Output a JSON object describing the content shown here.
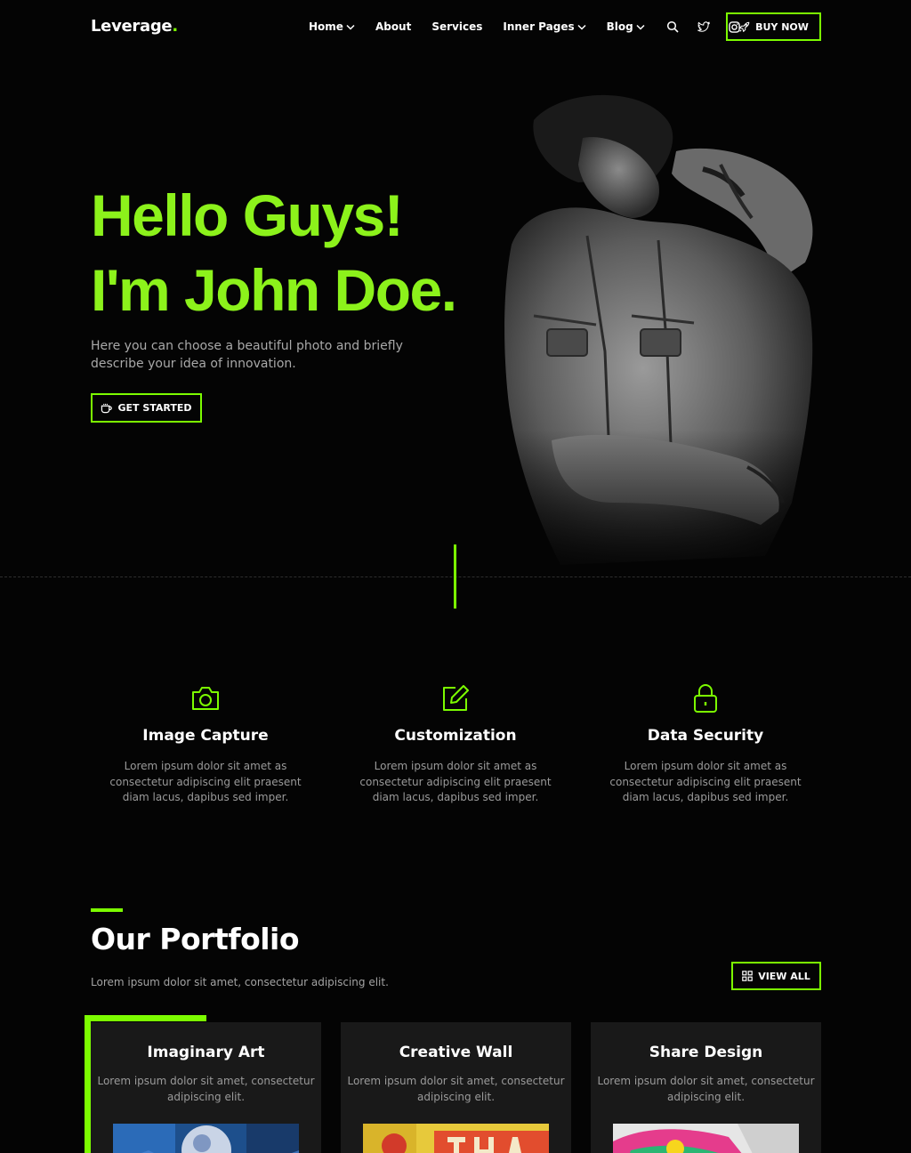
{
  "brand": {
    "name": "Leverage",
    "dot": ".",
    "accent": "#7cfc00"
  },
  "nav": {
    "items": [
      {
        "label": "Home",
        "dropdown": true
      },
      {
        "label": "About",
        "dropdown": false
      },
      {
        "label": "Services",
        "dropdown": false
      },
      {
        "label": "Inner Pages",
        "dropdown": true
      },
      {
        "label": "Blog",
        "dropdown": true
      }
    ],
    "icons": [
      "search-icon",
      "twitter-icon",
      "instagram-icon"
    ],
    "buy_label": "BUY NOW"
  },
  "hero": {
    "line1": "Hello Guys!",
    "line2": "I'm John Doe.",
    "description": "Here you can choose a beautiful photo and briefly describe your idea of innovation.",
    "cta_label": "GET STARTED"
  },
  "features": [
    {
      "icon": "camera-icon",
      "title": "Image Capture",
      "text": "Lorem ipsum dolor sit amet as consectetur adipiscing elit praesent diam lacus, dapibus sed imper."
    },
    {
      "icon": "edit-icon",
      "title": "Customization",
      "text": "Lorem ipsum dolor sit amet as consectetur adipiscing elit praesent diam lacus, dapibus sed imper."
    },
    {
      "icon": "lock-icon",
      "title": "Data Security",
      "text": "Lorem ipsum dolor sit amet as consectetur adipiscing elit praesent diam lacus, dapibus sed imper."
    }
  ],
  "portfolio": {
    "title": "Our Portfolio",
    "description": "Lorem ipsum dolor sit amet, consectetur adipiscing elit.",
    "view_all_label": "VIEW ALL",
    "cards": [
      {
        "title": "Imaginary Art",
        "text": "Lorem ipsum dolor sit amet, consectetur adipiscing elit."
      },
      {
        "title": "Creative Wall",
        "text": "Lorem ipsum dolor sit amet, consectetur adipiscing elit."
      },
      {
        "title": "Share Design",
        "text": "Lorem ipsum dolor sit amet, consectetur adipiscing elit."
      }
    ]
  }
}
